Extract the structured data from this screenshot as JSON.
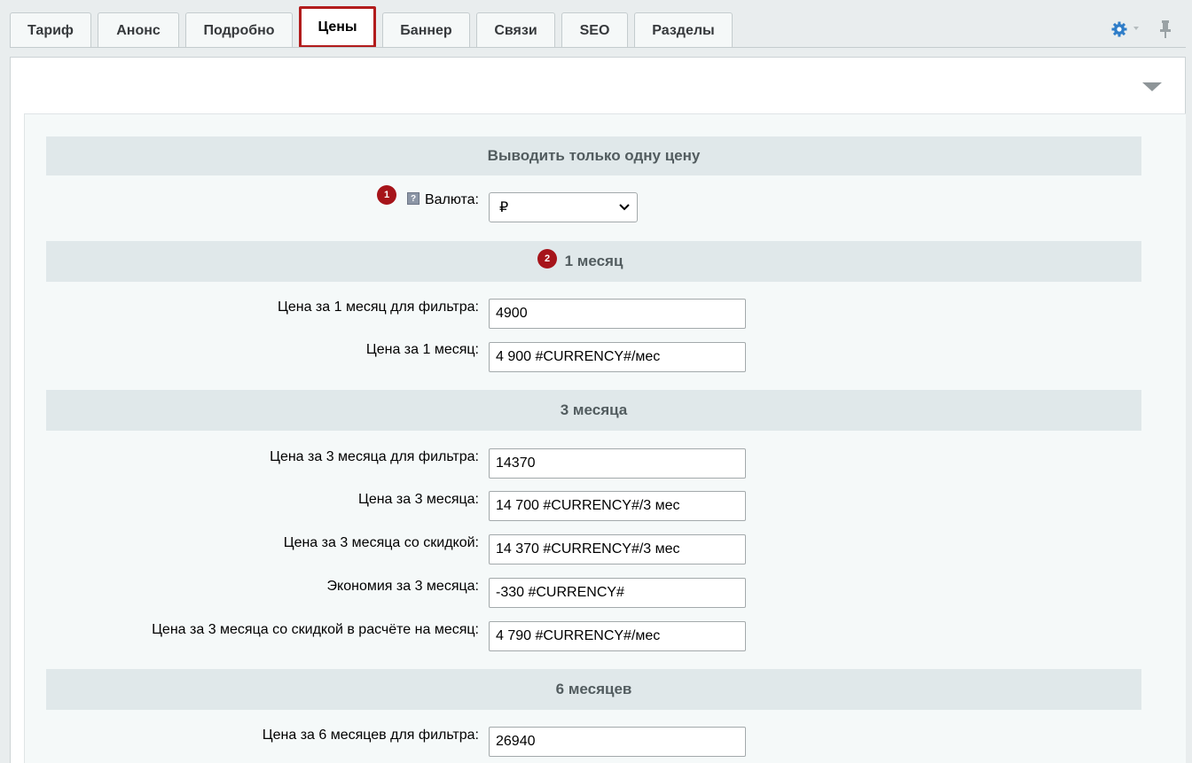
{
  "tabs": [
    {
      "label": "Тариф",
      "active": false
    },
    {
      "label": "Анонс",
      "active": false
    },
    {
      "label": "Подробно",
      "active": false
    },
    {
      "label": "Цены",
      "active": true
    },
    {
      "label": "Баннер",
      "active": false
    },
    {
      "label": "Связи",
      "active": false
    },
    {
      "label": "SEO",
      "active": false
    },
    {
      "label": "Разделы",
      "active": false
    }
  ],
  "toolbar": {
    "settings_icon": "gear-icon",
    "pin_icon": "pin-icon",
    "accent": "#2f7dc8"
  },
  "markers": {
    "currency": "1",
    "one_month": "2",
    "color": "#a6141a"
  },
  "sections": {
    "only_one_price": "Выводить только одну цену",
    "one_month": "1 месяц",
    "three_months": "3 месяца",
    "six_months": "6 месяцев"
  },
  "currency": {
    "label": "Валюта:",
    "help": "?",
    "selected": "₽"
  },
  "one_month": {
    "filter_label": "Цена за 1 месяц для фильтра:",
    "filter_value": "4900",
    "price_label": "Цена за 1 месяц:",
    "price_value": "4 900 #CURRENCY#/мес"
  },
  "three_months": {
    "filter_label": "Цена за 3 месяца для фильтра:",
    "filter_value": "14370",
    "price_label": "Цена за 3 месяца:",
    "price_value": "14 700 #CURRENCY#/3 мес",
    "discount_label": "Цена за 3 месяца со скидкой:",
    "discount_value": "14 370 #CURRENCY#/3 мес",
    "saving_label": "Экономия за 3 месяца:",
    "saving_value": "-330 #CURRENCY#",
    "per_month_label": "Цена за 3 месяца со скидкой в расчёте на месяц:",
    "per_month_value": "4 790 #CURRENCY#/мес"
  },
  "six_months": {
    "filter_label": "Цена за 6 месяцев для фильтра:",
    "filter_value": "26940"
  }
}
